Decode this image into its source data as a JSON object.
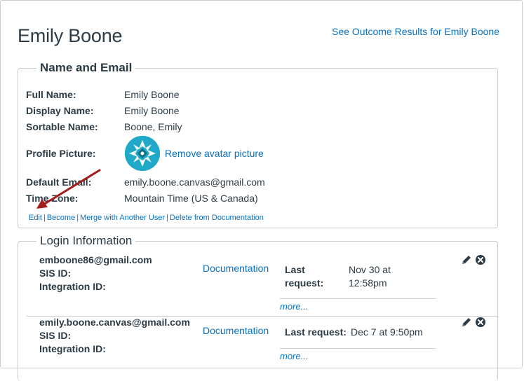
{
  "header": {
    "title": "Emily Boone",
    "outcome_link": "See Outcome Results for Emily Boone"
  },
  "name_email": {
    "legend": "Name and Email",
    "full_name_label": "Full Name:",
    "full_name": "Emily Boone",
    "display_name_label": "Display Name:",
    "display_name": "Emily Boone",
    "sortable_name_label": "Sortable Name:",
    "sortable_name": "Boone, Emily",
    "profile_picture_label": "Profile Picture:",
    "remove_avatar": "Remove avatar picture",
    "default_email_label": "Default Email:",
    "default_email": "emily.boone.canvas@gmail.com",
    "time_zone_label": "Time Zone:",
    "time_zone": "Mountain Time (US & Canada)",
    "actions": {
      "edit": "Edit",
      "become": "Become",
      "merge": "Merge with Another User",
      "delete": "Delete from Documentation",
      "separator": "|"
    }
  },
  "login_info": {
    "legend": "Login Information",
    "logins": [
      {
        "username": "emboone86@gmail.com",
        "sis_label": "SIS ID:",
        "integration_label": "Integration ID:",
        "auth_provider": "Documentation",
        "last_request_label_1": "Last",
        "last_request_label_2": "request:",
        "last_request_value_1": "Nov 30 at",
        "last_request_value_2": "12:58pm",
        "more": "more..."
      },
      {
        "username": "emily.boone.canvas@gmail.com",
        "sis_label": "SIS ID:",
        "integration_label": "Integration ID:",
        "auth_provider": "Documentation",
        "last_request_label": "Last request:",
        "last_request_value": "Dec 7 at 9:50pm",
        "more": "more..."
      }
    ]
  },
  "icons": {
    "edit": "pencil-icon",
    "delete": "remove-icon",
    "avatar": "profile-avatar"
  },
  "colors": {
    "link": "#0770c0",
    "text": "#2d3b45",
    "border": "#c7cdd1",
    "arrow": "#a31c1c"
  }
}
